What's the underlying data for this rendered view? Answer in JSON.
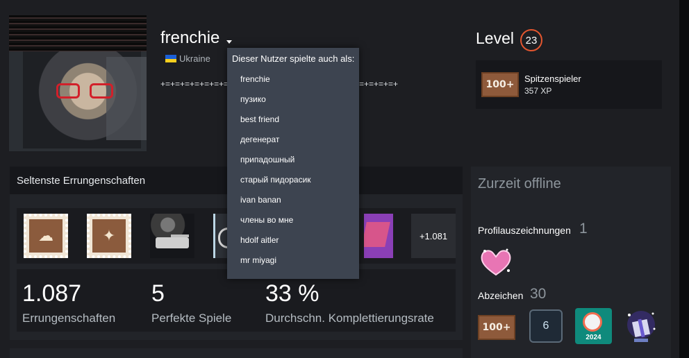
{
  "profile": {
    "username": "frenchie",
    "country": "Ukraine",
    "summary_left": "+=+=+=+=+=+=+=+=+=+",
    "summary_right": "=+=+=+=+"
  },
  "alias_dropdown": {
    "header": "Dieser Nutzer spielte auch als:",
    "items": [
      "frenchie",
      "пузико",
      "best friend",
      "дегенерат",
      "припадошный",
      "старый пидорасик",
      "ivan banan",
      "члены во мне",
      "hdolf aitler",
      "mr miyagi"
    ]
  },
  "level": {
    "label": "Level",
    "value": "23",
    "badge_text": "100+",
    "badge_title": "Spitzenspieler",
    "xp": "357 XP"
  },
  "achievements": {
    "title": "Seltenste Errungenschaften",
    "more": "+1.081",
    "stats": [
      {
        "value": "1.087",
        "label": "Errungenschaften"
      },
      {
        "value": "5",
        "label": "Perfekte Spiele"
      },
      {
        "value": "33 %",
        "label": "Durchschn. Komplettierungsrate"
      }
    ]
  },
  "sidebar": {
    "status": "Zurzeit offline",
    "awards_label": "Profilauszeichnungen",
    "awards_count": "1",
    "badges_label": "Abzeichen",
    "badges_count": "30",
    "badge_100_text": "100+",
    "badge_level_text": "6",
    "badge_year_text": "2024"
  },
  "colors": {
    "accent_level": "#e4562f",
    "dropdown_bg": "#3d4450",
    "flag_blue": "#1b5fd6",
    "flag_yellow": "#f7cf1e"
  },
  "icons": [
    "caret-down-icon",
    "ukraine-flag-icon",
    "nuke-stamp-icon",
    "wings-stamp-icon",
    "tank-icon",
    "heart-award-icon",
    "steam-2024-icon",
    "gift-badge-icon"
  ]
}
